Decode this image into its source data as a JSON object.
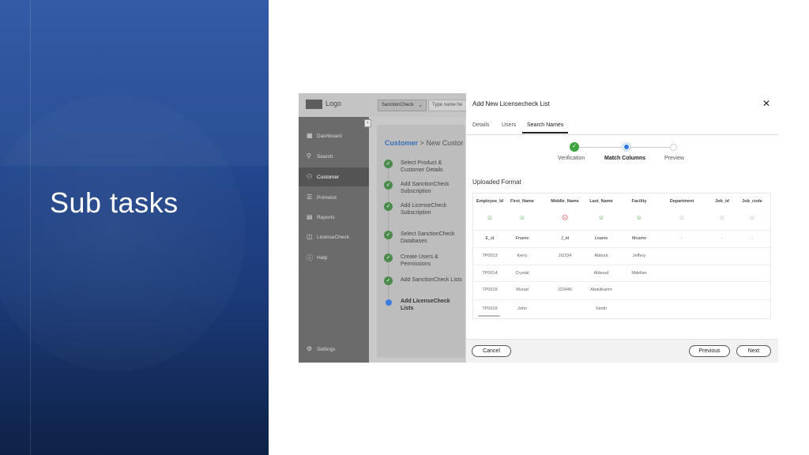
{
  "slide": {
    "title": "Sub tasks"
  },
  "app": {
    "logo_text": "Logo",
    "search_scope": "SanctionCheck",
    "search_placeholder": "Type name he",
    "collapse_icon": "chevron-left"
  },
  "sidebar": {
    "items": [
      {
        "label": "Dashboard",
        "icon": "grid-icon"
      },
      {
        "label": "Search",
        "icon": "search-icon"
      },
      {
        "label": "Customer",
        "icon": "users-icon"
      },
      {
        "label": "Primelist",
        "icon": "list-icon"
      },
      {
        "label": "Reports",
        "icon": "report-icon"
      },
      {
        "label": "LicenseCheck",
        "icon": "license-icon"
      },
      {
        "label": "Help",
        "icon": "help-icon"
      },
      {
        "label": "Settings",
        "icon": "gear-icon"
      }
    ]
  },
  "breadcrumb": {
    "root": "Customer",
    "current": " > New Custor"
  },
  "steps": [
    {
      "label": "Select Product & Customer Details",
      "status": "done"
    },
    {
      "label": "Add SanctionCheck Subscription",
      "status": "done"
    },
    {
      "label": "Add LicenseCheck Subscription",
      "status": "done"
    },
    {
      "label": "Select SanctionCheck Databases",
      "status": "done"
    },
    {
      "label": "Create Users & Permissions",
      "status": "done"
    },
    {
      "label": "Add SanctionCheck Lists",
      "status": "done"
    },
    {
      "label": "Add LicenseCheck Lists",
      "status": "current"
    }
  ],
  "modal": {
    "title": "Add New Licensecheck List",
    "tabs": [
      "Details",
      "Users",
      "Search Names"
    ],
    "active_tab": "Search Names",
    "stepper": [
      "Verification",
      "Match Columns",
      "Preview"
    ],
    "section_title": "Uploaded Format",
    "table": {
      "headers": [
        "Employee_Id",
        "First_Name",
        "Middle_Name",
        "Last_Name",
        "Facility",
        "Department",
        "Job_id",
        "Job_code"
      ],
      "match_status": [
        "match",
        "match",
        "error",
        "match",
        "match",
        "none",
        "none",
        "none"
      ],
      "mapped": [
        "E_id",
        "Fname",
        "J_id",
        "Lname",
        "Mname",
        "-",
        "-",
        "-"
      ],
      "rows": [
        [
          "TP0013",
          "Kerry",
          "JI2234",
          "Abbout",
          "Jeffery",
          "",
          "",
          ""
        ],
        [
          "TP0014",
          "Crystal",
          "",
          "Abboud",
          "Mdellan",
          "",
          "",
          ""
        ],
        [
          "TP0015",
          "Murad",
          "J23446",
          "Abdulkarim",
          "",
          "",
          "",
          ""
        ],
        [
          "TP0016",
          "John",
          "",
          "Smith",
          "",
          "",
          "",
          ""
        ]
      ]
    },
    "buttons": {
      "cancel": "Cancel",
      "previous": "Previous",
      "next": "Next"
    },
    "colors": {
      "success": "#3ea33e",
      "error": "#d84a4a",
      "accent": "#2f74e0"
    }
  }
}
